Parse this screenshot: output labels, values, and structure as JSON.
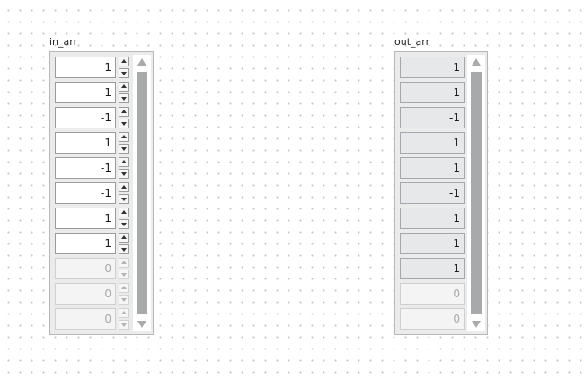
{
  "in_arr": {
    "label": "in_arr",
    "elements": [
      "1",
      "-1",
      "-1",
      "1",
      "-1",
      "-1",
      "1",
      "1",
      "0",
      "0",
      "0"
    ],
    "defined_count": 8
  },
  "out_arr": {
    "label": "out_arr",
    "elements": [
      "1",
      "1",
      "-1",
      "1",
      "1",
      "-1",
      "1",
      "1",
      "1",
      "0",
      "0"
    ],
    "defined_count": 9
  },
  "icons": {
    "increment": "triangle-up",
    "decrement": "triangle-down",
    "scroll_up": "triangle-up",
    "scroll_down": "triangle-down"
  },
  "colors": {
    "background": "#ffffff",
    "grid_dot": "#c4c4c4",
    "frame": "#ebebeb",
    "control_cell": "#ffffff",
    "indicator_cell": "#e6e8ea",
    "disabled_text": "#a8a8a8",
    "scroll_thumb": "#a8a9ab"
  }
}
